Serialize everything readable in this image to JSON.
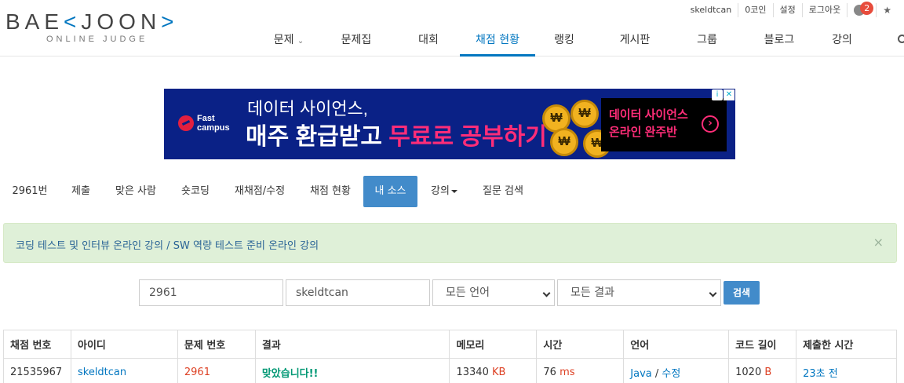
{
  "header": {
    "logo_main": "BAE",
    "logo_lt": "<",
    "logo_mid": "JOON",
    "logo_gt": ">",
    "logo_sub": "ONLINE JUDGE",
    "top_links": [
      "skeldtcan",
      "0코인",
      "설정",
      "로그아웃"
    ],
    "notif_count": "2",
    "star": "★",
    "nav": [
      "문제",
      "문제집",
      "대회",
      "채점 현황",
      "랭킹",
      "게시판",
      "그룹",
      "블로그",
      "강의"
    ],
    "nav_caret": "⌄"
  },
  "ad": {
    "brand_l1": "Fast",
    "brand_l2": "campus",
    "line1": "데이터 사이언스,",
    "line2_a": "매주 환급받고 ",
    "line2_b": "무료로 공부하기",
    "coin": "₩",
    "right_l1": "데이터 사이언스",
    "right_l2": "온라인 완주반",
    "arrow": "›",
    "info": "i",
    "close": "✕"
  },
  "subnav": [
    "2961번",
    "제출",
    "맞은 사람",
    "숏코딩",
    "재채점/수정",
    "채점 현황",
    "내 소스",
    "강의",
    "질문 검색"
  ],
  "alert": {
    "text": "코딩 테스트 및 인터뷰 온라인 강의 / SW 역량 테스트 준비 온라인 강의",
    "close": "×"
  },
  "form": {
    "problem": "2961",
    "user": "skeldtcan",
    "language": "모든 언어",
    "result": "모든 결과",
    "submit": "검색"
  },
  "table": {
    "headers": [
      "채점 번호",
      "아이디",
      "문제 번호",
      "결과",
      "메모리",
      "시간",
      "언어",
      "코드 길이",
      "제출한 시간"
    ],
    "row": {
      "id": "21535967",
      "user": "skeldtcan",
      "problem": "2961",
      "result": "맞았습니다!!",
      "memory": "13340",
      "memory_unit": " KB",
      "time": "76",
      "time_unit": " ms",
      "lang": "Java",
      "lang_sep": " / ",
      "lang_edit": "수정",
      "code_len": "1020",
      "code_unit": " B",
      "submitted": "23초 전"
    }
  },
  "colors": {
    "accent": "#0076c0",
    "active_tab": "#428bca",
    "accepted": "#009874",
    "alert_bg": "#dff0d8",
    "ad_bg": "#0a2186",
    "ad_pink": "#ff2d78"
  }
}
